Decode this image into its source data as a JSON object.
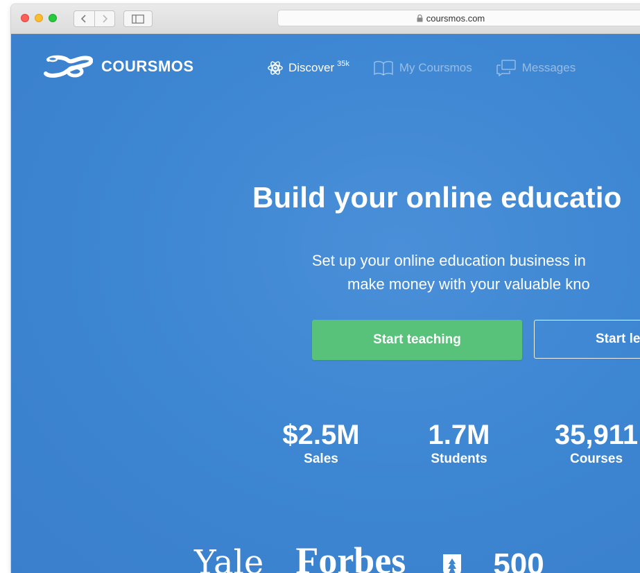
{
  "browser": {
    "url": "coursmos.com",
    "colors": {
      "close": "#fc5f57",
      "minimize": "#fdbc2e",
      "zoom": "#28c840"
    },
    "icons": [
      "back-icon",
      "forward-icon",
      "sidebar-icon",
      "lock-icon"
    ]
  },
  "site": {
    "brand": "COURSMOS",
    "accent": "#3d86d2",
    "nav": [
      {
        "label": "Discover",
        "badge": "35k",
        "icon": "atom-icon"
      },
      {
        "label": "My Coursmos",
        "icon": "book-icon"
      },
      {
        "label": "Messages",
        "icon": "chat-bubbles-icon"
      }
    ]
  },
  "hero": {
    "headline": "Build your online educatio",
    "subtitle_line1": "Set up your online education business in",
    "subtitle_line2": "make money with your valuable kno",
    "cta_primary": "Start teaching",
    "cta_primary_color": "#58c17a",
    "cta_secondary": "Start le"
  },
  "stats": [
    {
      "value": "$2.5M",
      "label": "Sales"
    },
    {
      "value": "1.7M",
      "label": "Students"
    },
    {
      "value": "35,911",
      "label": "Courses"
    }
  ],
  "press": {
    "yale": "Yale",
    "forbes": "Forbes",
    "five_hundred": "500"
  }
}
